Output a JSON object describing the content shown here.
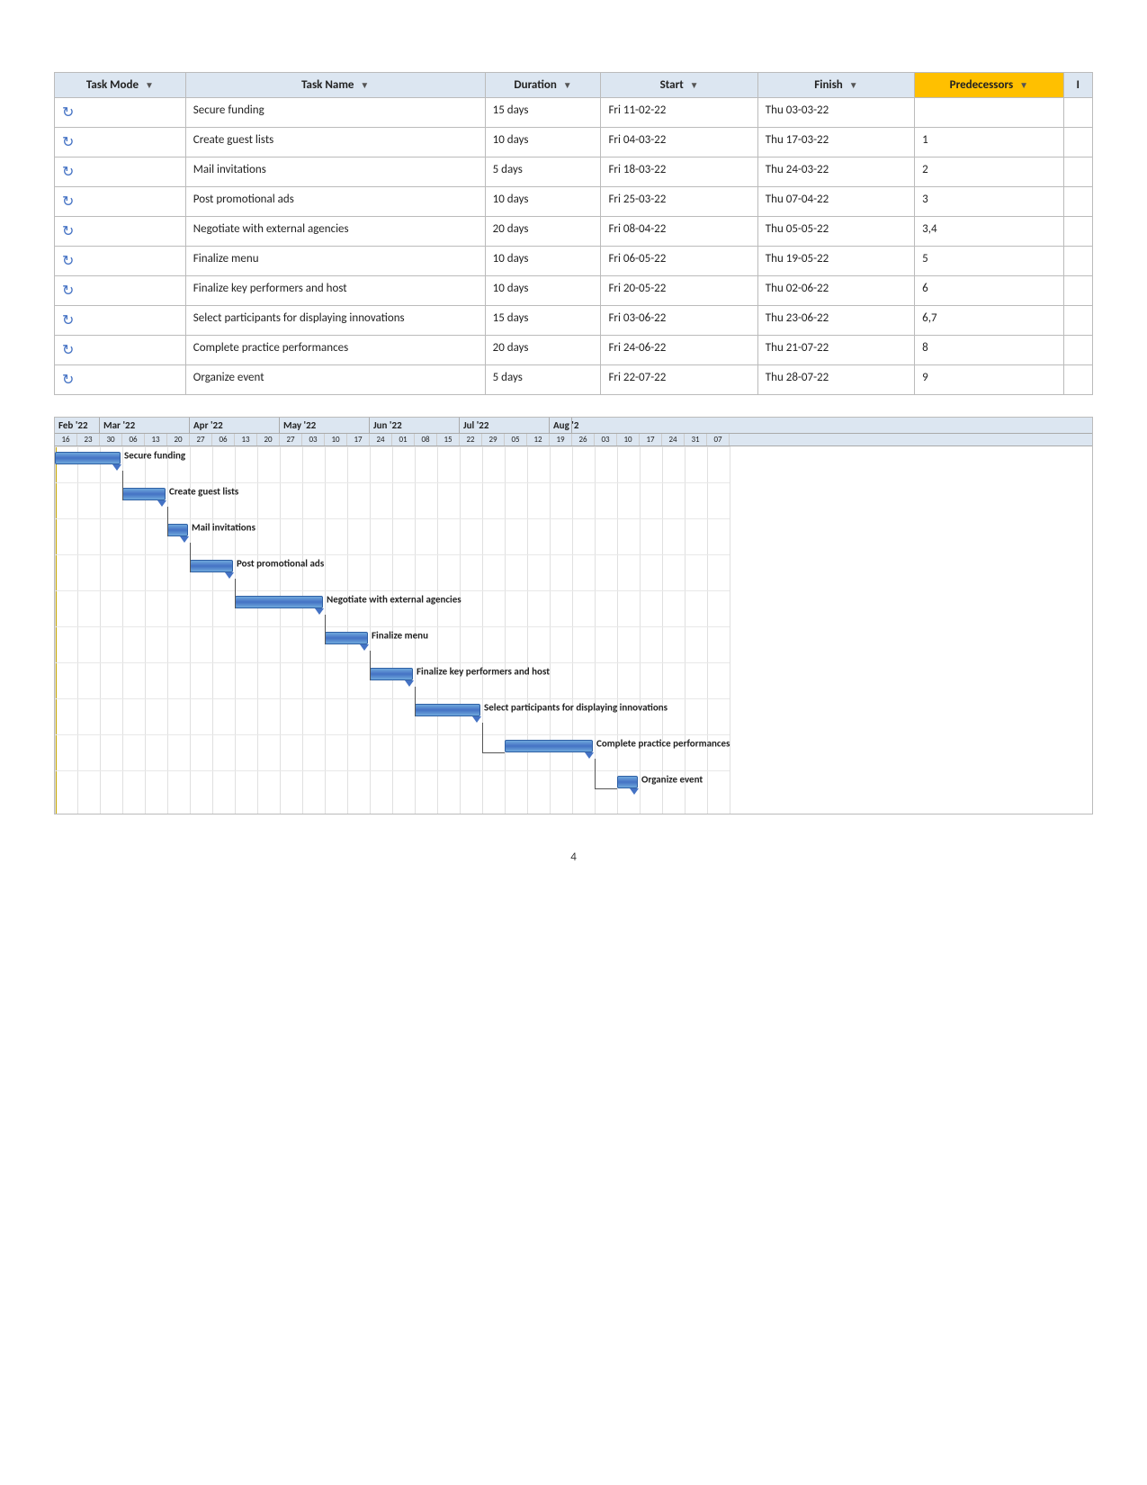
{
  "table": {
    "headers": [
      {
        "key": "mode",
        "label": "Task Mode",
        "cls": "col-mode",
        "sortable": true
      },
      {
        "key": "name",
        "label": "Task Name",
        "cls": "col-name",
        "sortable": true
      },
      {
        "key": "duration",
        "label": "Duration",
        "cls": "col-dur",
        "sortable": true
      },
      {
        "key": "start",
        "label": "Start",
        "cls": "col-start",
        "sortable": true
      },
      {
        "key": "finish",
        "label": "Finish",
        "cls": "col-fin",
        "sortable": true
      },
      {
        "key": "predecessors",
        "label": "Predecessors",
        "cls": "col-pred",
        "sortable": true,
        "highlight": true
      },
      {
        "key": "extra",
        "label": "I",
        "cls": "col-extra",
        "sortable": false
      }
    ],
    "rows": [
      {
        "name": "Secure funding",
        "duration": "15 days",
        "start": "Fri 11-02-22",
        "finish": "Thu 03-03-22",
        "predecessors": ""
      },
      {
        "name": "Create guest lists",
        "duration": "10 days",
        "start": "Fri 04-03-22",
        "finish": "Thu 17-03-22",
        "predecessors": "1"
      },
      {
        "name": "Mail invitations",
        "duration": "5 days",
        "start": "Fri 18-03-22",
        "finish": "Thu 24-03-22",
        "predecessors": "2"
      },
      {
        "name": "Post promotional ads",
        "duration": "10 days",
        "start": "Fri 25-03-22",
        "finish": "Thu 07-04-22",
        "predecessors": "3"
      },
      {
        "name": "Negotiate with external agencies",
        "duration": "20 days",
        "start": "Fri 08-04-22",
        "finish": "Thu 05-05-22",
        "predecessors": "3,4"
      },
      {
        "name": "Finalize menu",
        "duration": "10 days",
        "start": "Fri 06-05-22",
        "finish": "Thu 19-05-22",
        "predecessors": "5"
      },
      {
        "name": "Finalize key performers and host",
        "duration": "10 days",
        "start": "Fri 20-05-22",
        "finish": "Thu 02-06-22",
        "predecessors": "6"
      },
      {
        "name": "Select participants for displaying innovations",
        "duration": "15 days",
        "start": "Fri 03-06-22",
        "finish": "Thu 23-06-22",
        "predecessors": "6,7"
      },
      {
        "name": "Complete practice performances",
        "duration": "20 days",
        "start": "Fri 24-06-22",
        "finish": "Thu 21-07-22",
        "predecessors": "8"
      },
      {
        "name": "Organize event",
        "duration": "5 days",
        "start": "Fri 22-07-22",
        "finish": "Thu 28-07-22",
        "predecessors": "9"
      }
    ]
  },
  "gantt": {
    "months": [
      {
        "label": "Feb '22",
        "days": 2
      },
      {
        "label": "Mar '22",
        "days": 4
      },
      {
        "label": "Apr '22",
        "days": 4
      },
      {
        "label": "May '22",
        "days": 4
      },
      {
        "label": "Jun '22",
        "days": 4
      },
      {
        "label": "Jul '22",
        "days": 4
      },
      {
        "label": "Aug '2",
        "days": 1
      }
    ],
    "days": [
      "16",
      "23",
      "30",
      "06",
      "13",
      "20",
      "27",
      "06",
      "13",
      "20",
      "27",
      "03",
      "10",
      "17",
      "24",
      "01",
      "08",
      "15",
      "22",
      "29",
      "05",
      "12",
      "19",
      "26",
      "03",
      "10",
      "17",
      "24",
      "31",
      "07"
    ],
    "bars": [
      {
        "label": "Secure funding",
        "start_idx": 0,
        "span": 3,
        "label_left": true
      },
      {
        "label": "Create guest lists",
        "start_idx": 3,
        "span": 2
      },
      {
        "label": "Mail invitations",
        "start_idx": 5,
        "span": 1
      },
      {
        "label": "Post promotional ads",
        "start_idx": 6,
        "span": 2
      },
      {
        "label": "Negotiate with external agencies",
        "start_idx": 8,
        "span": 4
      },
      {
        "label": "Finalize menu",
        "start_idx": 12,
        "span": 2
      },
      {
        "label": "Finalize key performers and host",
        "start_idx": 14,
        "span": 2
      },
      {
        "label": "Select participants for displaying innovations",
        "start_idx": 16,
        "span": 3
      },
      {
        "label": "Complete practice performances",
        "start_idx": 20,
        "span": 4
      },
      {
        "label": "Organize event",
        "start_idx": 25,
        "span": 1
      }
    ]
  },
  "page_number": "4"
}
